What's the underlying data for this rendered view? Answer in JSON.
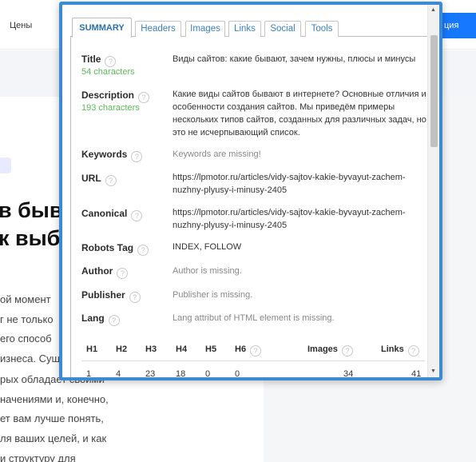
{
  "background": {
    "nav_item": "Цены",
    "cta_label": "ция",
    "headline_1": "в быв",
    "headline_2": "к выбр",
    "paragraph": [
      "ой момент",
      "г не только",
      "его способ",
      "изнеса. Сущ",
      "рых обладает своими",
      "начениями и, конечно,",
      "ет вам лучше понять,",
      "ля ваших целей, и как",
      "и структуру для"
    ]
  },
  "tabs": [
    "SUMMARY",
    "Headers",
    "Images",
    "Links",
    "Social",
    "Tools"
  ],
  "active_tab": "SUMMARY",
  "summary": {
    "title": {
      "label": "Title",
      "count": "54 characters",
      "value": "Виды сайтов: какие бывают, зачем нужны, плюсы и минусы"
    },
    "description": {
      "label": "Description",
      "count": "193 characters",
      "value": "Какие виды сайтов бывают в интернете? Основные отличия и особенности создания сайтов. Мы приведём примеры нескольких типов сайтов, созданных для различных задач, но это не исчерпывающий список."
    },
    "keywords": {
      "label": "Keywords",
      "value": "Keywords are missing!"
    },
    "url": {
      "label": "URL",
      "value": "https://lpmotor.ru/articles/vidy-sajtov-kakie-byvayut-zachem-nuzhny-plyusy-i-minusy-2405"
    },
    "canonical": {
      "label": "Canonical",
      "value": "https://lpmotor.ru/articles/vidy-sajtov-kakie-byvayut-zachem-nuzhny-plyusy-i-minusy-2405"
    },
    "robots": {
      "label": "Robots Tag",
      "value": "INDEX, FOLLOW"
    },
    "author": {
      "label": "Author",
      "value": "Author is missing."
    },
    "publisher": {
      "label": "Publisher",
      "value": "Publisher is missing."
    },
    "lang": {
      "label": "Lang",
      "value": "Lang attribut of HTML element is missing."
    }
  },
  "stats": {
    "headers": [
      "H1",
      "H2",
      "H3",
      "H4",
      "H5",
      "H6",
      "Images",
      "Links"
    ],
    "values": [
      "1",
      "4",
      "23",
      "18",
      "0",
      "0",
      "34",
      "41"
    ]
  },
  "help_icon": "?"
}
